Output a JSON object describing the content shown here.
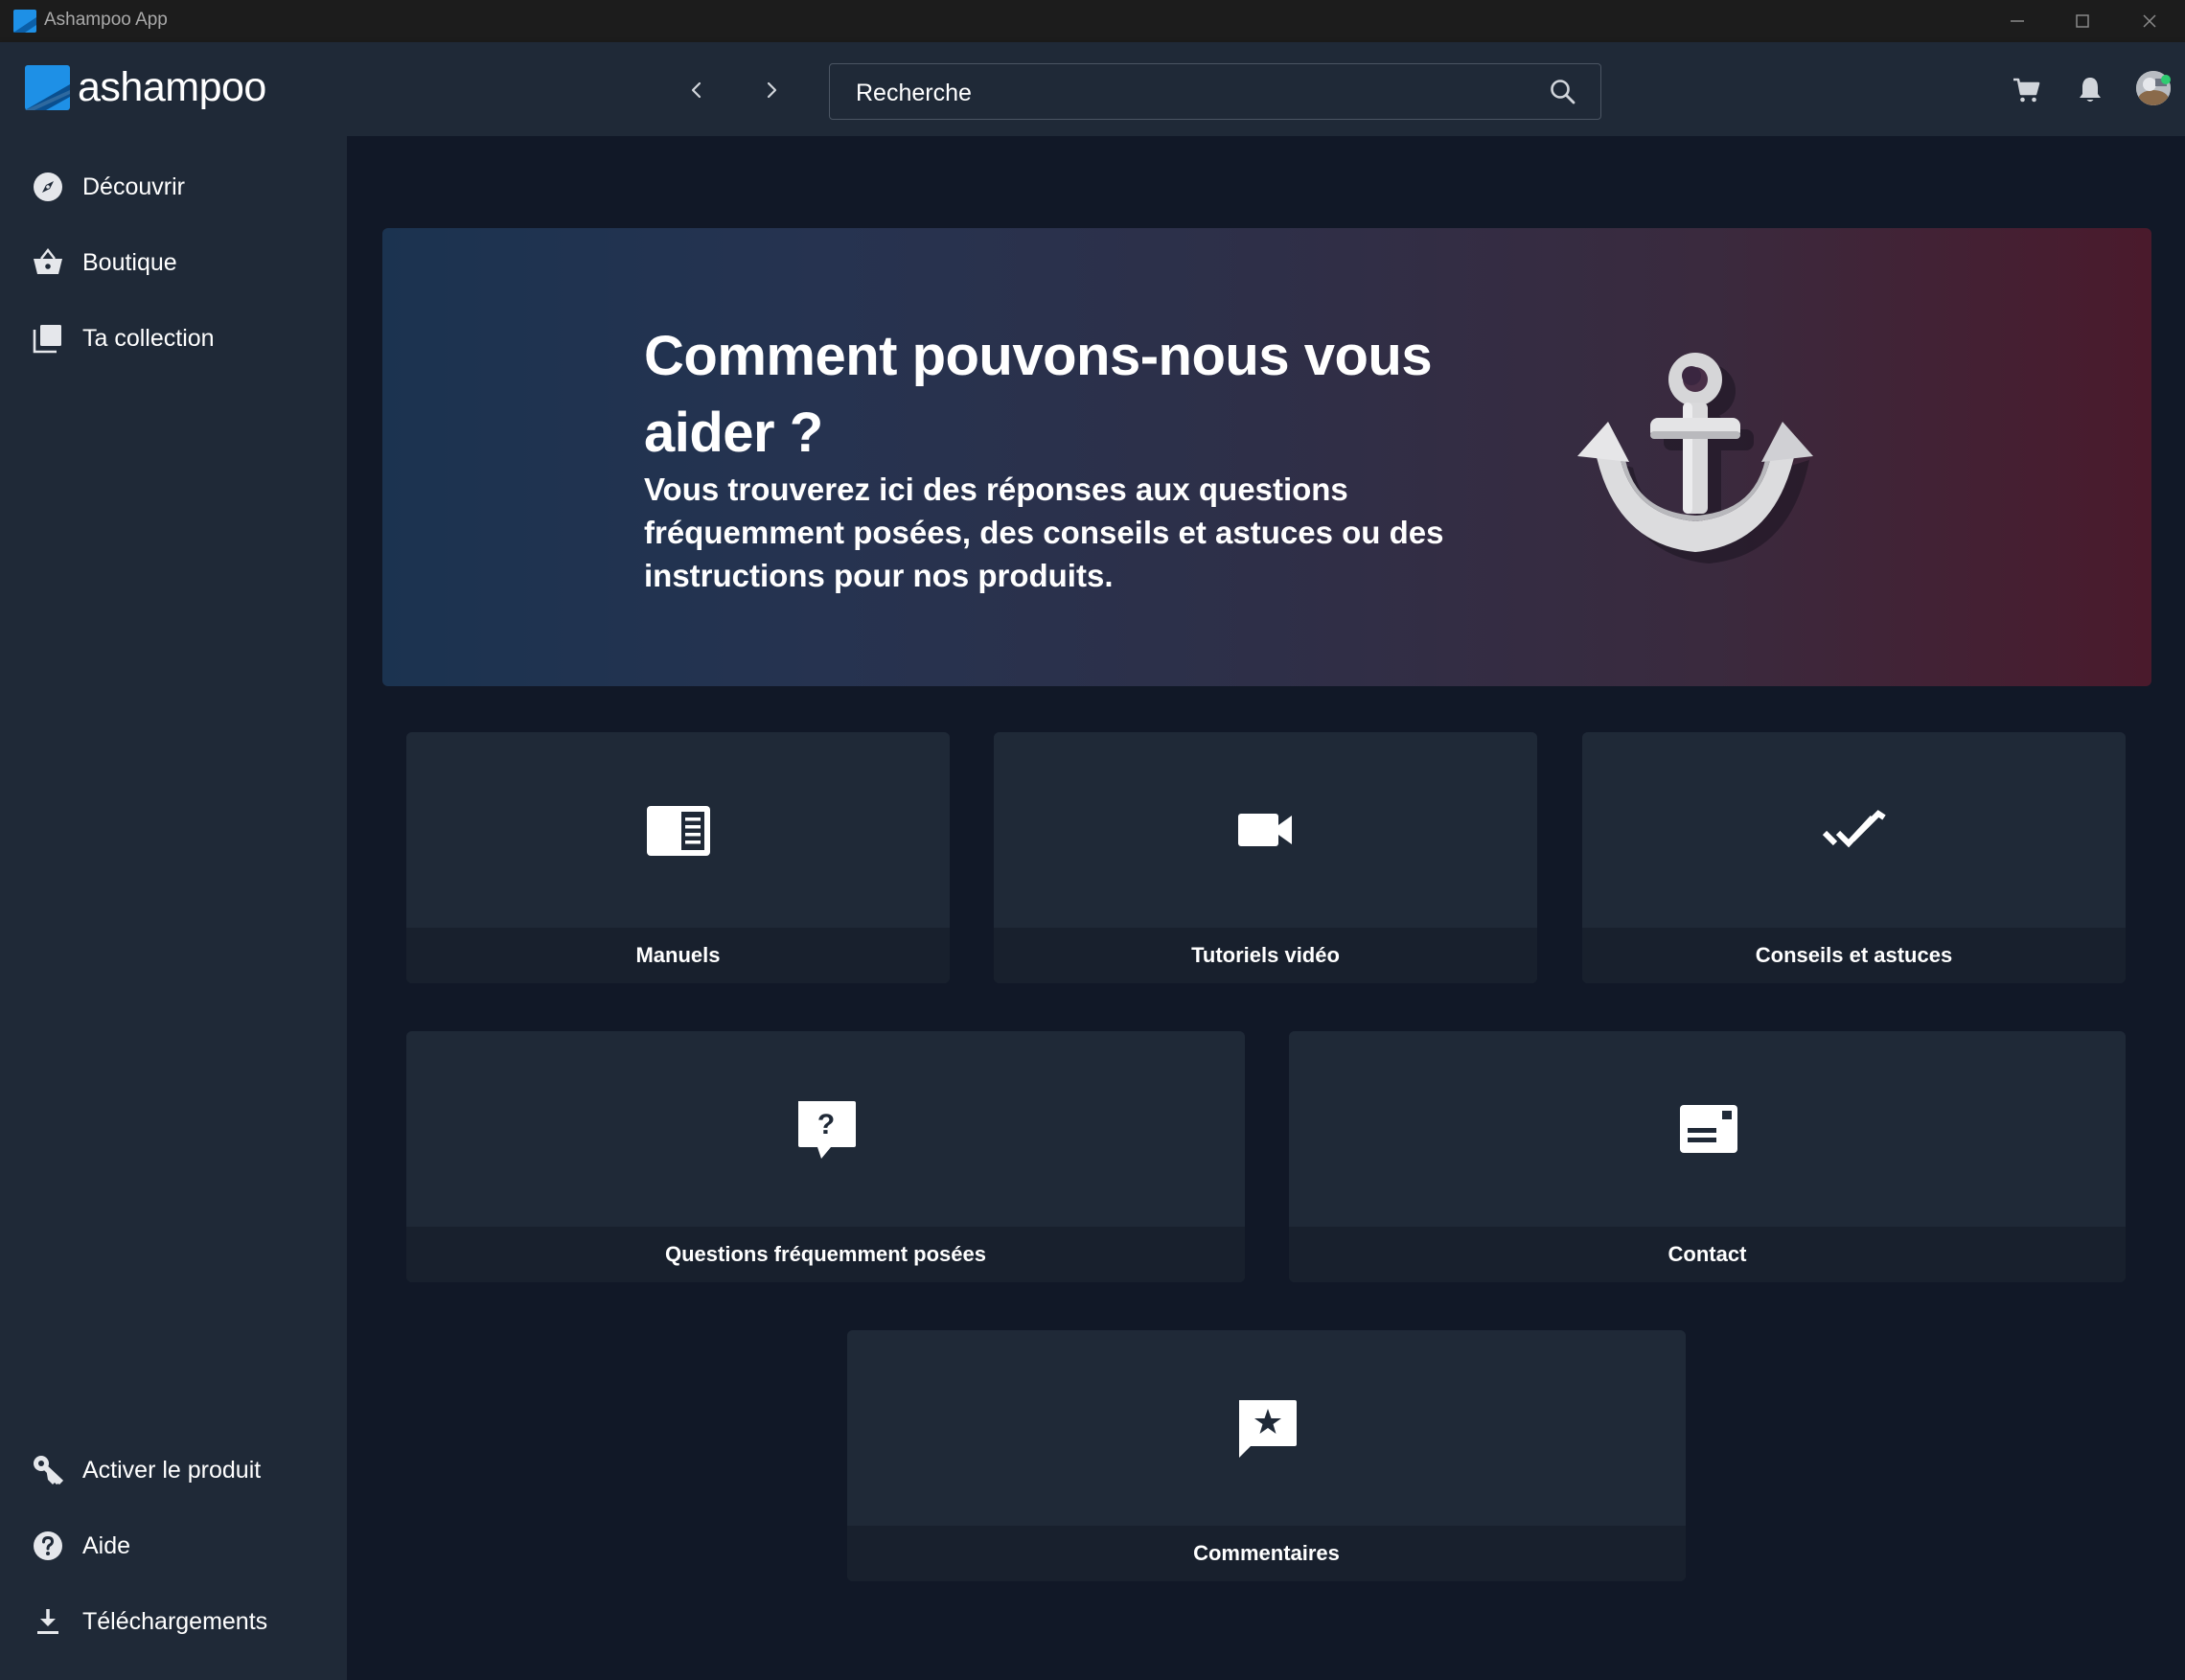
{
  "window": {
    "title": "Ashampoo App"
  },
  "header": {
    "logo_text": "ashampoo",
    "search_placeholder": "Recherche"
  },
  "sidebar": {
    "top_items": [
      {
        "label": "Découvrir",
        "icon": "compass-icon"
      },
      {
        "label": "Boutique",
        "icon": "basket-icon"
      },
      {
        "label": "Ta collection",
        "icon": "collection-icon"
      }
    ],
    "bottom_items": [
      {
        "label": "Activer le produit",
        "icon": "key-icon"
      },
      {
        "label": "Aide",
        "icon": "help-icon"
      },
      {
        "label": "Téléchargements",
        "icon": "download-icon"
      }
    ]
  },
  "hero": {
    "title": "Comment pouvons-nous vous aider ?",
    "subtitle": "Vous trouverez ici des réponses aux questions fréquemment posées, des conseils et astuces ou des instructions pour nos produits."
  },
  "tiles": [
    {
      "label": "Manuels",
      "icon": "manual-icon"
    },
    {
      "label": "Tutoriels vidéo",
      "icon": "video-camera-icon"
    },
    {
      "label": "Conseils et astuces",
      "icon": "double-check-icon"
    },
    {
      "label": "Questions fréquemment posées",
      "icon": "question-bubble-icon"
    },
    {
      "label": "Contact",
      "icon": "contact-card-icon"
    },
    {
      "label": "Commentaires",
      "icon": "feedback-star-icon"
    }
  ],
  "colors": {
    "background": "#111827",
    "panel": "#1f2937",
    "accent": "#1e90e6",
    "hero_left": "#1b3350",
    "hero_right": "#4a1a2c"
  }
}
